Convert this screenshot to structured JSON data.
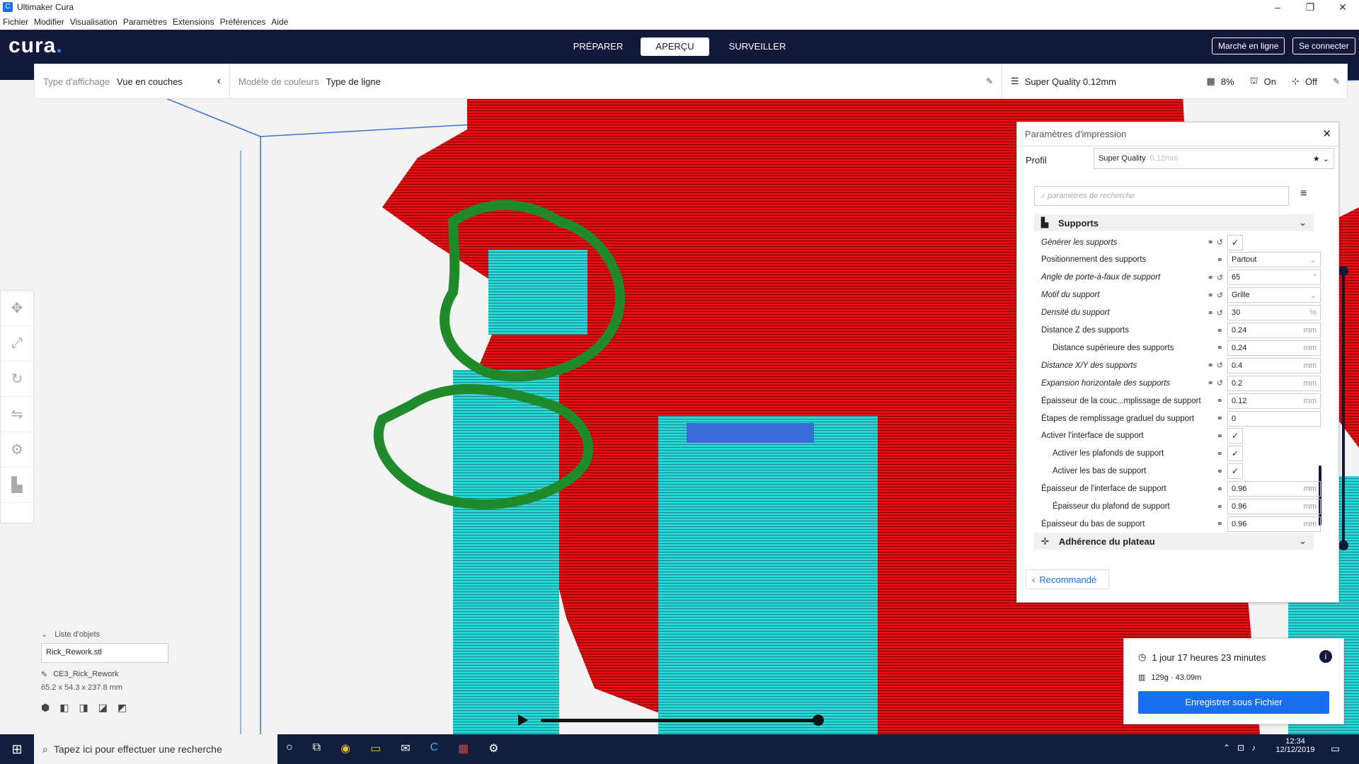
{
  "window": {
    "title": "Ultimaker Cura"
  },
  "menu": [
    "Fichier",
    "Modifier",
    "Visualisation",
    "Paramètres",
    "Extensions",
    "Préférences",
    "Aide"
  ],
  "header": {
    "logo": "cura",
    "stages": [
      "PRÉPARER",
      "APERÇU",
      "SURVEILLER"
    ],
    "active_stage": "APERÇU",
    "marketplace": "Marché en ligne",
    "login": "Se connecter"
  },
  "toolbar": {
    "view_type_label": "Type d'affichage",
    "view_type_value": "Vue en couches",
    "color_model_label": "Modèle de couleurs",
    "color_model_value": "Type de ligne",
    "profile": "Super Quality 0.12mm",
    "infill": "8%",
    "support": "On",
    "adhesion": "Off"
  },
  "panel": {
    "title": "Paramètres d'impression",
    "profile_label": "Profil",
    "profile_value": "Super Quality",
    "profile_sub": "0.12mm",
    "search_placeholder": "paramètres de recherche",
    "category_supports": "Supports",
    "category_adhesion": "Adhérence du plateau",
    "rows": [
      {
        "label": "Générer les supports",
        "value": "✓",
        "type": "check",
        "italic": true
      },
      {
        "label": "Positionnement des supports",
        "value": "Partout",
        "type": "select",
        "italic": false
      },
      {
        "label": "Angle de porte-à-faux de support",
        "value": "65",
        "unit": "°",
        "type": "num",
        "italic": true
      },
      {
        "label": "Motif du support",
        "value": "Grille",
        "type": "select",
        "italic": true
      },
      {
        "label": "Densité du support",
        "value": "30",
        "unit": "%",
        "type": "num",
        "italic": true
      },
      {
        "label": "Distance Z des supports",
        "value": "0.24",
        "unit": "mm",
        "type": "num",
        "italic": false
      },
      {
        "label": "Distance supérieure des supports",
        "value": "0.24",
        "unit": "mm",
        "type": "num",
        "italic": false
      },
      {
        "label": "Distance X/Y des supports",
        "value": "0.4",
        "unit": "mm",
        "type": "num",
        "italic": true
      },
      {
        "label": "Expansion horizontale des supports",
        "value": "0.2",
        "unit": "mm",
        "type": "num",
        "italic": true
      },
      {
        "label": "Épaisseur de la couc...mplissage de support",
        "value": "0.12",
        "unit": "mm",
        "type": "num",
        "italic": false
      },
      {
        "label": "Étapes de remplissage graduel du support",
        "value": "0",
        "unit": "",
        "type": "num",
        "italic": false
      },
      {
        "label": "Activer l'interface de support",
        "value": "✓",
        "type": "check",
        "italic": false
      },
      {
        "label": "Activer les plafonds de support",
        "value": "✓",
        "type": "check",
        "italic": false
      },
      {
        "label": "Activer les bas de support",
        "value": "✓",
        "type": "check",
        "italic": false
      },
      {
        "label": "Épaisseur de l'interface de support",
        "value": "0.96",
        "unit": "mm",
        "type": "num",
        "italic": false
      },
      {
        "label": "Épaisseur du plafond de support",
        "value": "0.96",
        "unit": "mm",
        "type": "num",
        "italic": false
      },
      {
        "label": "Épaisseur du bas de support",
        "value": "0.96",
        "unit": "mm",
        "type": "num",
        "italic": false
      }
    ],
    "recommended": "Recommandé"
  },
  "objects": {
    "header": "Liste d'objets",
    "file": "Rick_Rework.stl",
    "job": "CE3_Rick_Rework",
    "dims": "65.2 x 54.3 x 237.8 mm"
  },
  "printinfo": {
    "time": "1 jour 17 heures 23 minutes",
    "material": "129g · 43.09m",
    "save": "Enregistrer sous Fichier"
  },
  "taskbar": {
    "search": "Tapez ici pour effectuer une recherche",
    "time": "12:34",
    "date": "12/12/2019"
  },
  "colors": {
    "header": "#12193b",
    "accent": "#196ef0",
    "model": "#e01010",
    "support": "#2dd6d6",
    "annotation": "#1f8a2a"
  }
}
